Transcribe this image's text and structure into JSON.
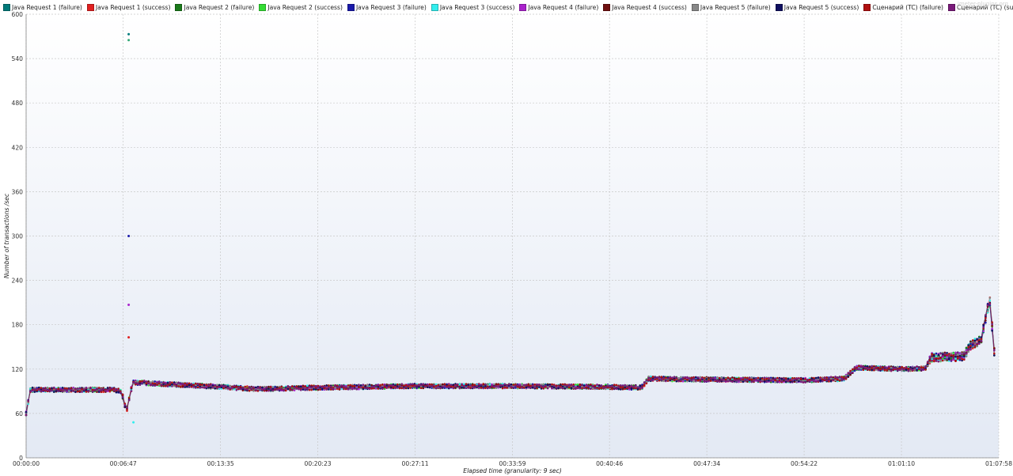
{
  "watermark": "jmeter-plugins.org",
  "chart_data": {
    "type": "line",
    "title": "",
    "xlabel": "Elapsed time (granularity: 9 sec)",
    "ylabel": "Number of transactions /sec",
    "ylim": [
      0,
      600
    ],
    "yticks": [
      0,
      60,
      120,
      180,
      240,
      300,
      360,
      420,
      480,
      540,
      600
    ],
    "xlim": [
      "00:00:00",
      "01:07:58"
    ],
    "xticks": [
      "00:00:00",
      "00:06:47",
      "00:13:35",
      "00:20:23",
      "00:27:11",
      "00:33:59",
      "00:40:46",
      "00:47:34",
      "00:54:22",
      "01:01:10",
      "01:07:58"
    ],
    "grid": true,
    "legend_position": "top",
    "series": [
      {
        "name": "Java Request 1 (failure)",
        "color": "#007a7a"
      },
      {
        "name": "Java Request 1 (success)",
        "color": "#e02020"
      },
      {
        "name": "Java Request 2 (failure)",
        "color": "#1a7a1a"
      },
      {
        "name": "Java Request 2 (success)",
        "color": "#33dd33"
      },
      {
        "name": "Java Request 3 (failure)",
        "color": "#1a1aaa"
      },
      {
        "name": "Java Request 3 (success)",
        "color": "#33eeee"
      },
      {
        "name": "Java Request 4 (failure)",
        "color": "#aa22cc"
      },
      {
        "name": "Java Request 4 (success)",
        "color": "#701010"
      },
      {
        "name": "Java Request 5 (failure)",
        "color": "#888888"
      },
      {
        "name": "Java Request 5 (success)",
        "color": "#101060"
      },
      {
        "name": "Сценарий (TC) (failure)",
        "color": "#b01010"
      },
      {
        "name": "Сценарий (TC) (success)",
        "color": "#7a1a7a"
      }
    ],
    "trend": [
      {
        "t": "00:00:00",
        "v": 60
      },
      {
        "t": "00:00:18",
        "v": 92
      },
      {
        "t": "00:06:00",
        "v": 92
      },
      {
        "t": "00:06:40",
        "v": 90
      },
      {
        "t": "00:07:00",
        "v": 62
      },
      {
        "t": "00:07:27",
        "v": 102
      },
      {
        "t": "00:13:35",
        "v": 96
      },
      {
        "t": "00:16:00",
        "v": 93
      },
      {
        "t": "00:20:23",
        "v": 95
      },
      {
        "t": "00:27:11",
        "v": 97
      },
      {
        "t": "00:33:59",
        "v": 97
      },
      {
        "t": "00:40:46",
        "v": 96
      },
      {
        "t": "00:43:00",
        "v": 95
      },
      {
        "t": "00:43:30",
        "v": 107
      },
      {
        "t": "00:47:34",
        "v": 106
      },
      {
        "t": "00:54:22",
        "v": 105
      },
      {
        "t": "00:57:10",
        "v": 107
      },
      {
        "t": "00:58:00",
        "v": 122
      },
      {
        "t": "01:01:10",
        "v": 120
      },
      {
        "t": "01:02:50",
        "v": 121
      },
      {
        "t": "01:03:15",
        "v": 136
      },
      {
        "t": "01:05:30",
        "v": 137
      },
      {
        "t": "01:06:00",
        "v": 152
      },
      {
        "t": "01:06:45",
        "v": 160
      },
      {
        "t": "01:07:20",
        "v": 215
      },
      {
        "t": "01:07:40",
        "v": 140
      }
    ],
    "spikes": [
      {
        "t": "00:07:10",
        "v": 573
      },
      {
        "t": "00:07:10",
        "v": 565
      },
      {
        "t": "00:07:10",
        "v": 300
      },
      {
        "t": "00:07:10",
        "v": 207
      },
      {
        "t": "00:07:10",
        "v": 163
      },
      {
        "t": "00:07:30",
        "v": 48
      }
    ]
  }
}
